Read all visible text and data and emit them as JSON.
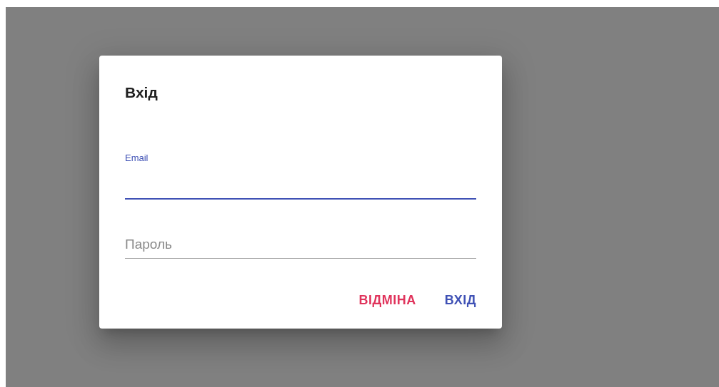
{
  "dialog": {
    "title": "Вхід",
    "fields": [
      {
        "label": "Email",
        "focused": true
      },
      {
        "placeholder": "Пароль",
        "focused": false
      }
    ],
    "buttons": [
      {
        "label": "ВІДМІНА",
        "kind": "cancel"
      },
      {
        "label": "ВХІД",
        "kind": "confirm"
      }
    ]
  }
}
